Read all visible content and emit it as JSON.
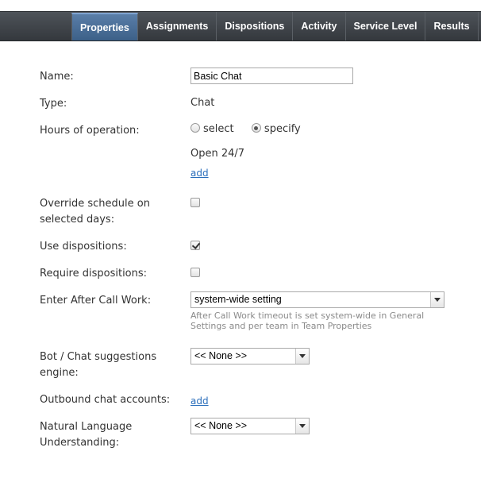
{
  "tabs": [
    {
      "label": "Properties",
      "active": true
    },
    {
      "label": "Assignments",
      "active": false
    },
    {
      "label": "Dispositions",
      "active": false
    },
    {
      "label": "Activity",
      "active": false
    },
    {
      "label": "Service Level",
      "active": false
    },
    {
      "label": "Results",
      "active": false
    }
  ],
  "form": {
    "name": {
      "label": "Name:",
      "value": "Basic Chat"
    },
    "type": {
      "label": "Type:",
      "value": "Chat"
    },
    "hours": {
      "label": "Hours of operation:",
      "option_select": "select",
      "option_specify": "specify",
      "selected": "specify",
      "schedule": "Open 24/7",
      "add_link": "add"
    },
    "override": {
      "label_line1": "Override schedule on",
      "label_line2": "selected days:",
      "checked": false
    },
    "use_dispositions": {
      "label": "Use dispositions:",
      "checked": true
    },
    "require_dispositions": {
      "label": "Require dispositions:",
      "checked": false
    },
    "after_call_work": {
      "label": "Enter After Call Work:",
      "value": "system-wide setting",
      "help_line1": "After Call Work timeout is set system-wide in General",
      "help_line2": "Settings and per team in Team Properties"
    },
    "bot": {
      "label_line1": "Bot / Chat suggestions",
      "label_line2": "engine:",
      "value": "<< None >>"
    },
    "outbound": {
      "label": "Outbound chat accounts:",
      "add_link": "add"
    },
    "nlu": {
      "label_line1": "Natural Language",
      "label_line2": "Understanding:",
      "value": "<< None >>"
    }
  }
}
